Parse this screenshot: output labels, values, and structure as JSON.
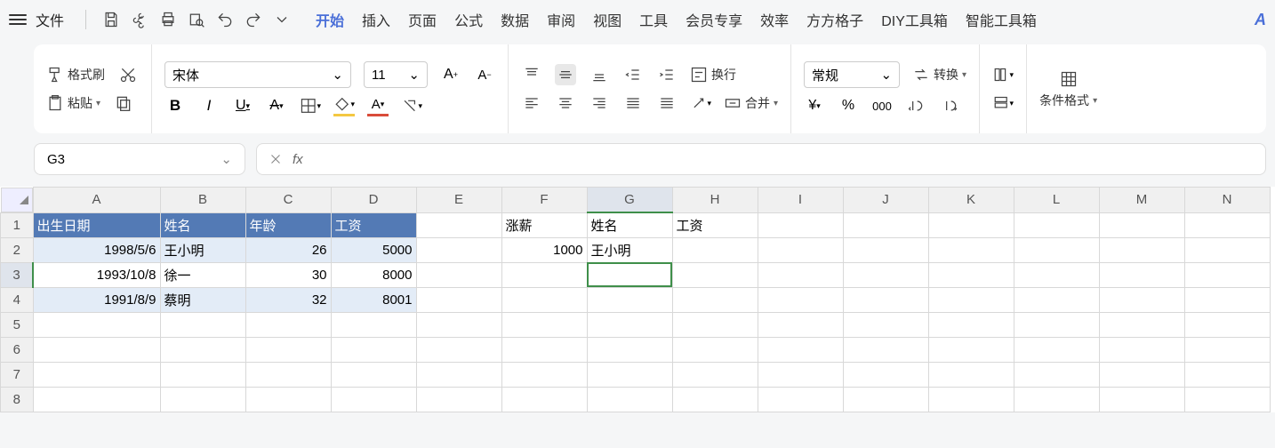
{
  "menubar": {
    "file_label": "文件",
    "tabs": [
      "开始",
      "插入",
      "页面",
      "公式",
      "数据",
      "审阅",
      "视图",
      "工具",
      "会员专享",
      "效率",
      "方方格子",
      "DIY工具箱",
      "智能工具箱"
    ],
    "active_tab_index": 0
  },
  "ribbon": {
    "format_painter": "格式刷",
    "paste": "粘贴",
    "font_name": "宋体",
    "font_size": "11",
    "wrap_text": "换行",
    "merge": "合并",
    "number_format": "常规",
    "convert": "转换",
    "conditional_format": "条件格式"
  },
  "name_box": {
    "value": "G3"
  },
  "formula_bar": {
    "fx_label": "fx",
    "value": ""
  },
  "columns": [
    "A",
    "B",
    "C",
    "D",
    "E",
    "F",
    "G",
    "H",
    "I",
    "J",
    "K",
    "L",
    "M",
    "N"
  ],
  "rows": [
    "1",
    "2",
    "3",
    "4",
    "5",
    "6",
    "7",
    "8"
  ],
  "headers": {
    "A1": "出生日期",
    "B1": "姓名",
    "C1": "年龄",
    "D1": "工资",
    "F1": "涨薪",
    "G1": "姓名",
    "H1": "工资"
  },
  "cells": {
    "A2": "1998/5/6",
    "B2": "王小明",
    "C2": "26",
    "D2": "5000",
    "A3": "1993/10/8",
    "B3": "徐一",
    "C3": "30",
    "D3": "8000",
    "A4": "1991/8/9",
    "B4": "蔡明",
    "C4": "32",
    "D4": "8001",
    "F2": "1000",
    "G2": "王小明"
  },
  "active_cell": "G3",
  "style": {
    "header_bg": "#537ab5",
    "band_bg": "#e3ecf7",
    "selection_border": "#3f8f4a"
  }
}
